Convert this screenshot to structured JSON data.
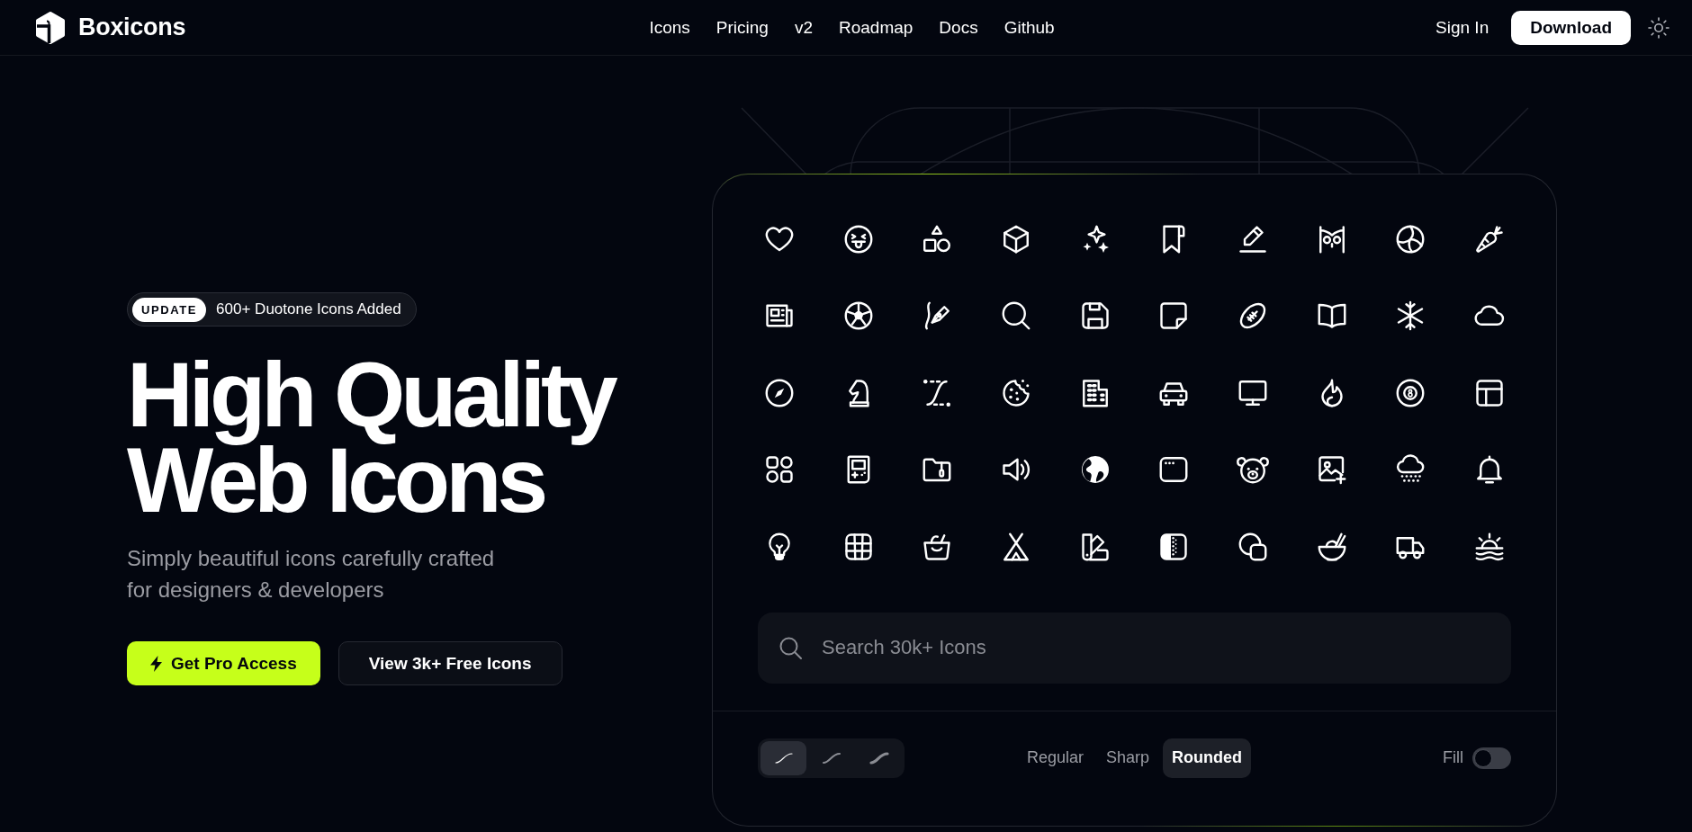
{
  "header": {
    "brand": "Boxicons",
    "nav": [
      "Icons",
      "Pricing",
      "v2",
      "Roadmap",
      "Docs",
      "Github"
    ],
    "sign_in": "Sign In",
    "download": "Download"
  },
  "hero": {
    "badge": {
      "tag": "UPDATE",
      "text": "600+ Duotone Icons Added"
    },
    "title": "High Quality Web Icons",
    "subtitle": "Simply beautiful icons carefully crafted for designers & developers",
    "buttons": [
      {
        "label": "Get Pro Access",
        "kind": "primary"
      },
      {
        "label": "View 3k+ Free Icons",
        "kind": "secondary"
      }
    ]
  },
  "showcase": {
    "search": {
      "placeholder": "Search 30k+ Icons"
    },
    "stroke_options": [
      {
        "kind": "thin",
        "selected": true
      },
      {
        "kind": "medium",
        "selected": false
      },
      {
        "kind": "bold",
        "selected": false
      }
    ],
    "styles": [
      {
        "label": "Regular",
        "selected": false
      },
      {
        "label": "Sharp",
        "selected": false
      },
      {
        "label": "Rounded",
        "selected": true
      }
    ],
    "fill": {
      "label": "Fill",
      "on": false
    }
  }
}
